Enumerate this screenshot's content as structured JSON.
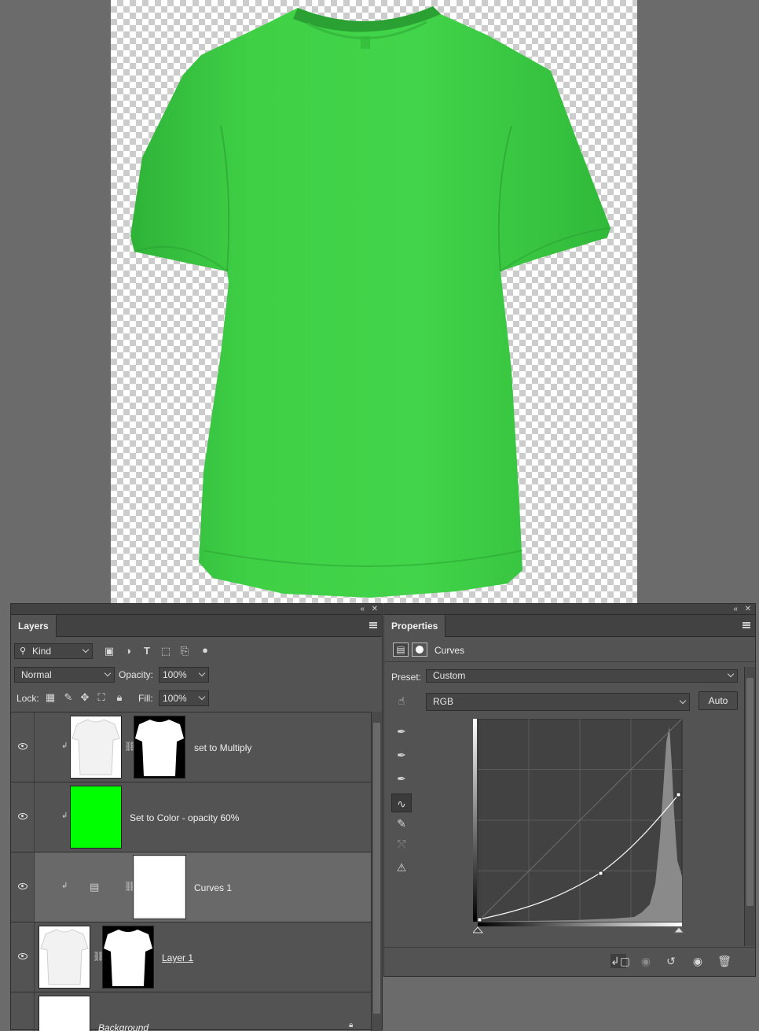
{
  "layers_panel": {
    "tab": "Layers",
    "filter_kind": "Kind",
    "blend_mode": "Normal",
    "opacity_label": "Opacity:",
    "opacity_value": "100%",
    "lock_label": "Lock:",
    "fill_label": "Fill:",
    "fill_value": "100%",
    "layers": [
      {
        "name": "set to Multiply",
        "visible": true
      },
      {
        "name": "Set to Color - opacity 60%",
        "visible": true,
        "fill": "#00ff00"
      },
      {
        "name": "Curves 1",
        "visible": true,
        "selected": true
      },
      {
        "name": "Layer 1",
        "visible": true
      },
      {
        "name": "Background",
        "visible": false,
        "locked": true
      }
    ]
  },
  "properties_panel": {
    "tab": "Properties",
    "adjustment": "Curves",
    "preset_label": "Preset:",
    "preset_value": "Custom",
    "channel": "RGB",
    "auto_label": "Auto",
    "curve_points": [
      [
        0,
        0
      ],
      [
        0.6,
        0.23
      ],
      [
        1,
        0.63
      ]
    ]
  },
  "colors": {
    "shirt": "#3fd046",
    "accent_green": "#00ff00"
  }
}
